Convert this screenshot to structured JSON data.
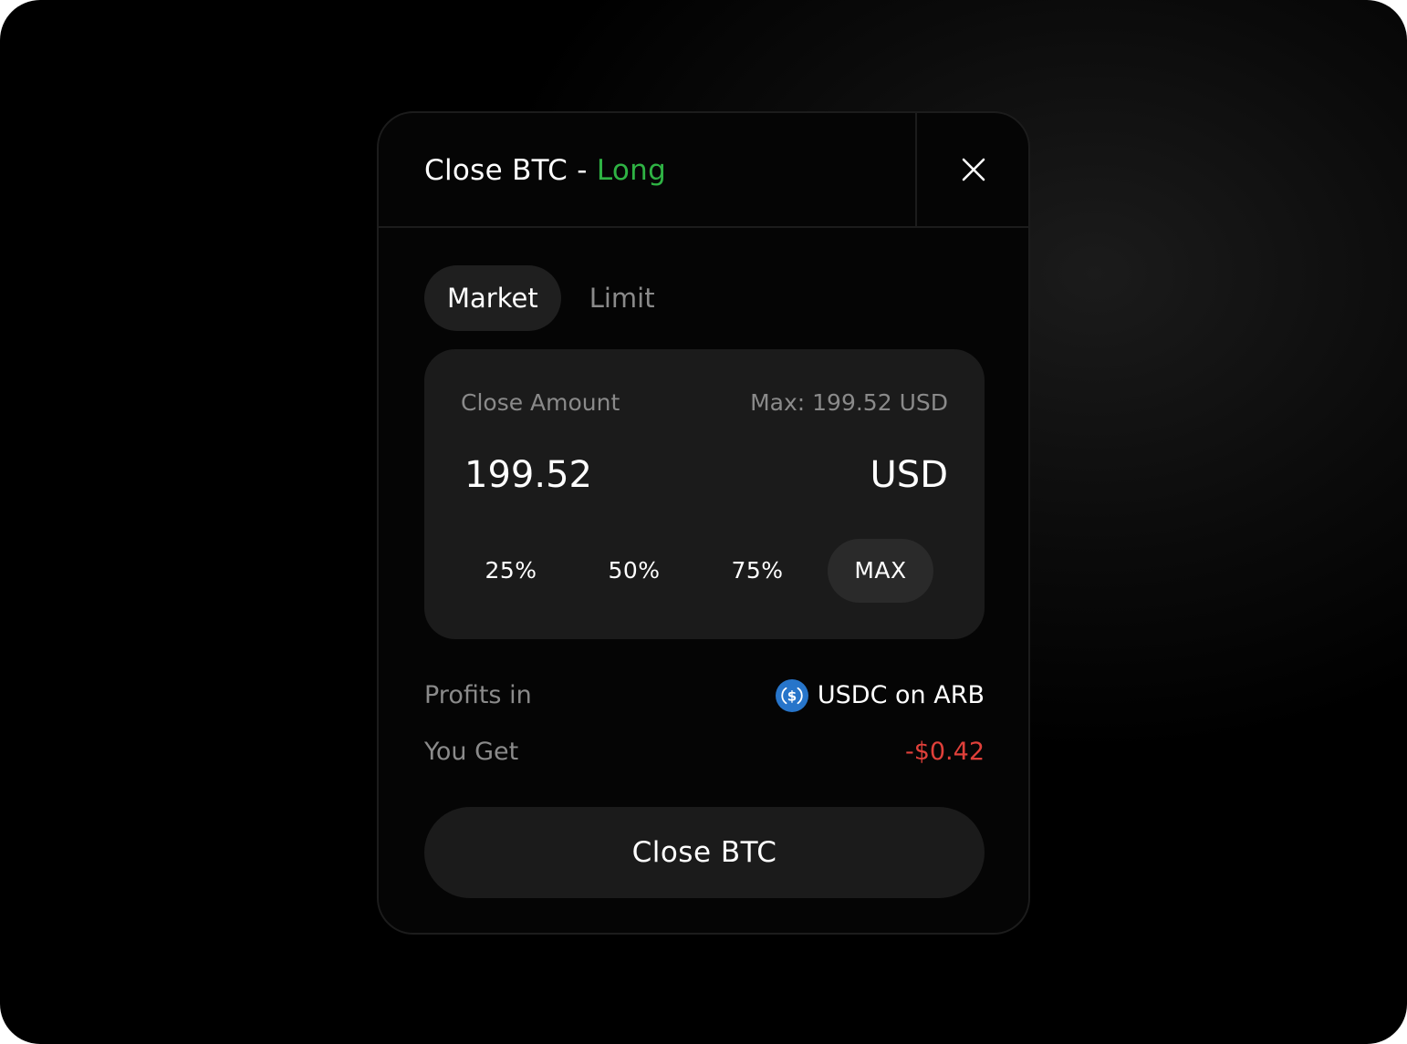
{
  "modal": {
    "title_prefix": "Close BTC - ",
    "title_side": "Long",
    "side_color": "#2fb344",
    "close_icon": "close-icon"
  },
  "tabs": [
    {
      "label": "Market",
      "active": true
    },
    {
      "label": "Limit",
      "active": false
    }
  ],
  "amount": {
    "label": "Close Amount",
    "max_label": "Max: 199.52 USD",
    "value": "199.52",
    "unit": "USD",
    "presets": [
      {
        "label": "25%",
        "active": false
      },
      {
        "label": "50%",
        "active": false
      },
      {
        "label": "75%",
        "active": false
      },
      {
        "label": "MAX",
        "active": true
      }
    ]
  },
  "profits": {
    "label": "Profits in",
    "token_icon": "usdc-icon",
    "value": "USDC on ARB"
  },
  "you_get": {
    "label": "You Get",
    "value": "-$0.42",
    "value_color": "#e0403a"
  },
  "submit": {
    "label": "Close BTC"
  }
}
